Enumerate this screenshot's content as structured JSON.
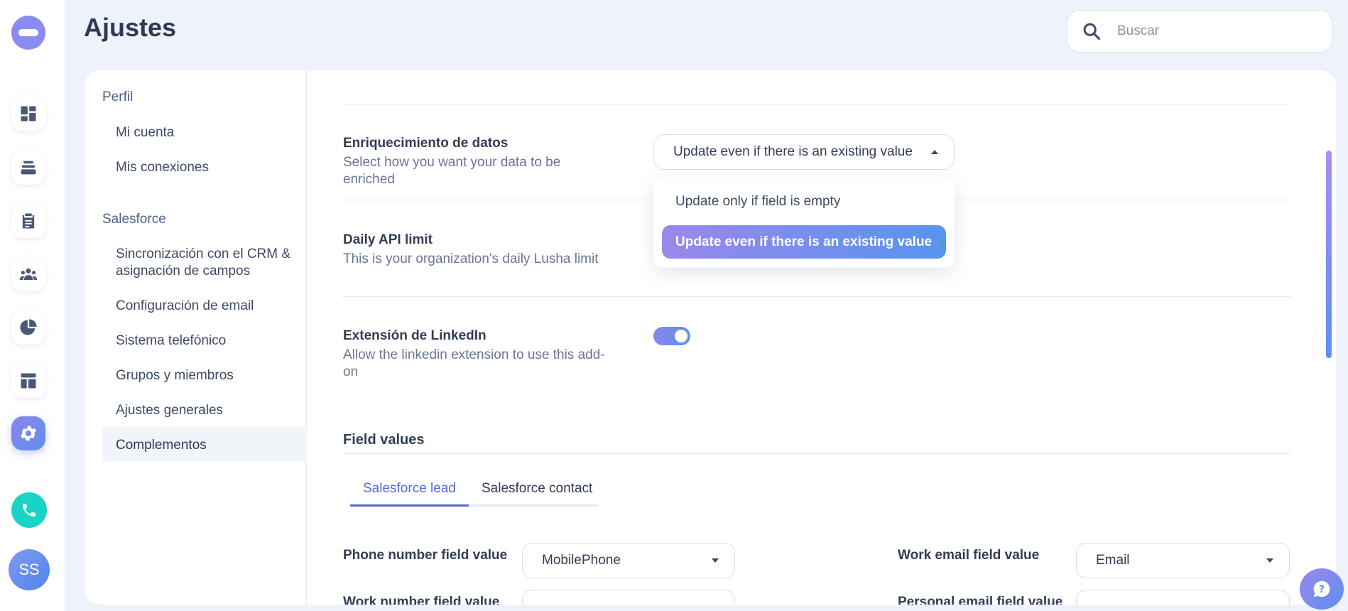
{
  "header": {
    "title": "Ajustes",
    "search_placeholder": "Buscar"
  },
  "rail": {
    "icons": [
      "dashboard-icon",
      "layers-icon",
      "clipboard-icon",
      "team-icon",
      "pie-chart-icon",
      "layout-icon",
      "settings-icon"
    ],
    "active": "settings-icon",
    "avatar_initials": "SS"
  },
  "subnav": {
    "sections": [
      {
        "title": "Perfil",
        "items": [
          "Mi cuenta",
          "Mis conexiones"
        ]
      },
      {
        "title": "Salesforce",
        "items": [
          "Sincronización con el CRM & asignación de campos",
          "Configuración de email",
          "Sistema telefónico",
          "Grupos y miembros",
          "Ajustes generales",
          "Complementos"
        ]
      }
    ],
    "active_item": "Complementos"
  },
  "settings": {
    "enrichment": {
      "label": "Enriquecimiento de datos",
      "description": "Select how you want your data to be enriched",
      "selected": "Update even if there is an existing value",
      "options": [
        "Update only if field is empty",
        "Update even if there is an existing value"
      ]
    },
    "daily_api": {
      "label": "Daily API limit",
      "description": "This is your organization's daily Lusha limit"
    },
    "linkedin": {
      "label": "Extensión de LinkedIn",
      "description": "Allow the linkedin extension to use this add-on",
      "enabled": true
    }
  },
  "field_values": {
    "title": "Field values",
    "tabs": [
      "Salesforce lead",
      "Salesforce contact"
    ],
    "active_tab": "Salesforce lead",
    "phone_label": "Phone number field value",
    "phone_value": "MobilePhone",
    "work_email_label": "Work email field value",
    "work_email_value": "Email",
    "work_number_label": "Work number field value",
    "personal_email_label": "Personal email field value"
  },
  "colors": {
    "accent": "#5a68d8",
    "gradient_start": "#9a88ec",
    "gradient_end": "#5794ee",
    "phone": "#19d3c4"
  }
}
